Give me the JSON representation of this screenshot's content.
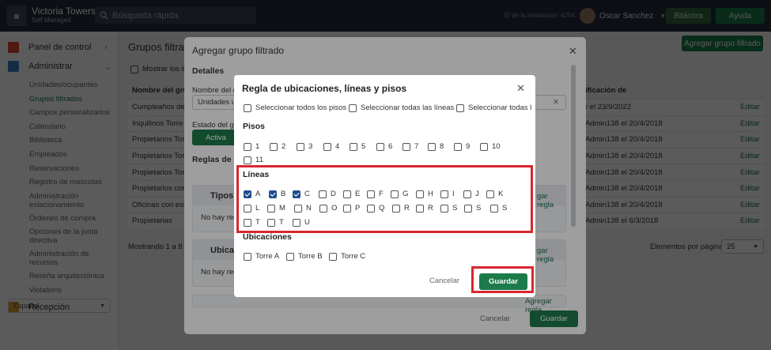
{
  "topbar": {
    "app_title": "Victoria Towers",
    "app_subtitle": "Self Managed",
    "search_placeholder": "Búsqueda rápida",
    "installation_id": "ID de la instalación: 4254",
    "user_name": "Oscar Sanchez",
    "bitacora_label": "Bitácora",
    "ayuda_label": "Ayuda"
  },
  "sidebar": {
    "panel_label": "Panel de control",
    "admin_label": "Administrar",
    "items": [
      "Unidades/ocupantes",
      "Grupos filtrados",
      "Campos personalizados",
      "Calendario",
      "Biblioteca",
      "Empleados",
      "Reservaciones",
      "Registro de mascotas",
      "Administración",
      "estacionamiento",
      "Órdenes de compra",
      "Opciones de la junta",
      "directiva",
      "Administración de",
      "recursos",
      "Reseña arquitectónica",
      "Violations"
    ],
    "reception_label": "Recepción",
    "language": "Español"
  },
  "page": {
    "title": "Grupos filtrad",
    "add_button": "Agregar grupo filtrado",
    "show_inactive_label": "Mostrar los in",
    "columns": [
      "Nombre del grup",
      "ificación de"
    ],
    "rows": [
      {
        "name": "Cumpleaños de S",
        "modified": "r el 23/9/2022",
        "edit": "Editar"
      },
      {
        "name": "Inquilinos Torre T",
        "modified": "Admin138 el 20/4/2018",
        "edit": "Editar"
      },
      {
        "name": "Propietarios Tor",
        "modified": "Admin138 el 20/4/2018",
        "edit": "Editar"
      },
      {
        "name": "Propietarios Tor",
        "modified": "Admin138 el 20/4/2018",
        "edit": "Editar"
      },
      {
        "name": "Propietarios Tor",
        "modified": "Admin138 el 20/4/2018",
        "edit": "Editar"
      },
      {
        "name": "Propietarios con",
        "modified": "Admin138 el 20/4/2018",
        "edit": "Editar"
      },
      {
        "name": "Oficinas con esta",
        "modified": "Admin138 el 20/4/2018",
        "edit": "Editar"
      },
      {
        "name": "Propietarias",
        "modified": "Admin138 el 6/3/2018",
        "edit": "Editar"
      }
    ],
    "showing_label": "Mostrando 1 a 8 d",
    "per_page_label": "Elementos por página",
    "per_page_value": "25"
  },
  "modal_group": {
    "title": "Agregar grupo filtrado",
    "details_heading": "Detalles",
    "name_label": "Nombre del gr",
    "name_value": "Unidades u",
    "state_label": "Estado del gr",
    "state_value": "Activa",
    "rules_heading": "Reglas de r",
    "tipos_heading": "Tipos",
    "tipos_empty": "No hay reg",
    "tipos_link": "gar regla",
    "ubica_heading": "Ubica",
    "ubica_empty": "No hay reg",
    "ubica_link": "gar regla",
    "third_link": "Agregar regla",
    "cancel_label": "Cancelar",
    "save_label": "Guardar"
  },
  "modal_rule": {
    "title": "Regla de ubicaciones, líneas y pisos",
    "select_all": [
      "Seleccionar todos los pisos",
      "Seleccionar todas las líneas",
      "Seleccionar todas l"
    ],
    "pisos_heading": "Pisos",
    "pisos": [
      {
        "label": "1",
        "checked": false
      },
      {
        "label": "2",
        "checked": false
      },
      {
        "label": "3",
        "checked": false
      },
      {
        "label": "4",
        "checked": false
      },
      {
        "label": "5",
        "checked": false
      },
      {
        "label": "6",
        "checked": false
      },
      {
        "label": "7",
        "checked": false
      },
      {
        "label": "8",
        "checked": false
      },
      {
        "label": "9",
        "checked": false
      },
      {
        "label": "10",
        "checked": false
      },
      {
        "label": "11",
        "checked": false
      }
    ],
    "lineas_heading": "Líneas",
    "lineas": [
      {
        "label": "A",
        "checked": true
      },
      {
        "label": "B",
        "checked": true
      },
      {
        "label": "C",
        "checked": true
      },
      {
        "label": "D",
        "checked": false
      },
      {
        "label": "E",
        "checked": false
      },
      {
        "label": "F",
        "checked": false
      },
      {
        "label": "G",
        "checked": false
      },
      {
        "label": "H",
        "checked": false
      },
      {
        "label": "I",
        "checked": false
      },
      {
        "label": "J",
        "checked": false
      },
      {
        "label": "K",
        "checked": false
      },
      {
        "label": "L",
        "checked": false
      },
      {
        "label": "M",
        "checked": false
      },
      {
        "label": "N",
        "checked": false
      },
      {
        "label": "O",
        "checked": false
      },
      {
        "label": "P",
        "checked": false
      },
      {
        "label": "Q",
        "checked": false
      },
      {
        "label": "R",
        "checked": false
      },
      {
        "label": "R",
        "checked": false
      },
      {
        "label": "S",
        "checked": false
      },
      {
        "label": "S",
        "checked": false
      },
      {
        "label": "S",
        "checked": false
      },
      {
        "label": "T",
        "checked": false
      },
      {
        "label": "T",
        "checked": false
      },
      {
        "label": "U",
        "checked": false
      }
    ],
    "ubicaciones_heading": "Ubicaciones",
    "ubicaciones": [
      {
        "label": "Torre A",
        "checked": false
      },
      {
        "label": "Torre B",
        "checked": false
      },
      {
        "label": "Torre C",
        "checked": false
      }
    ],
    "cancel_label": "Cancelar",
    "save_label": "Guardar",
    "highlight_color": "#d8272d",
    "accent_color": "#1d7a4a"
  }
}
